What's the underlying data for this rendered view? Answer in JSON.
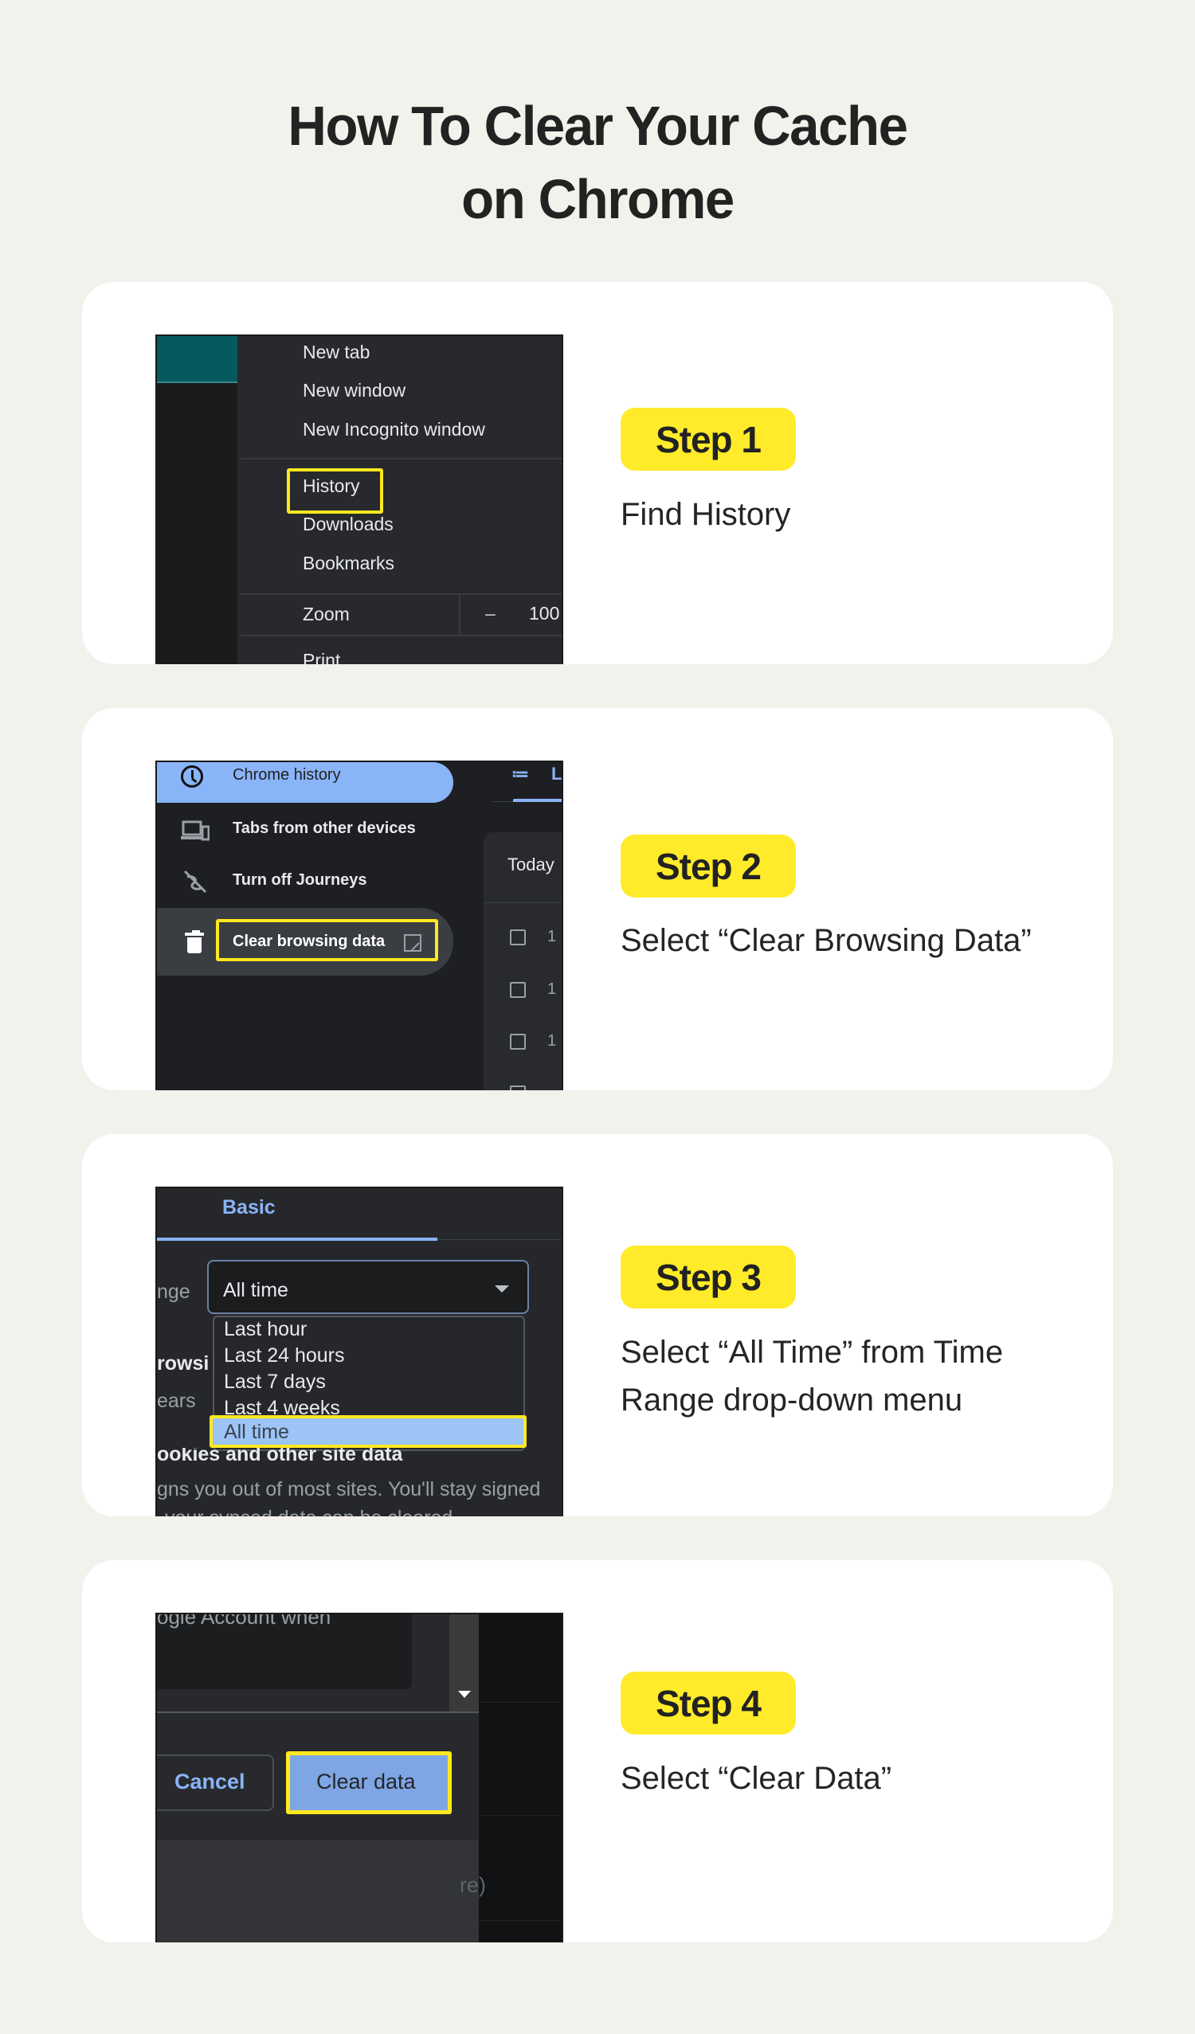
{
  "page": {
    "title_line1": "How To Clear Your Cache",
    "title_line2": "on Chrome",
    "colors": {
      "background": "#f3f1ec",
      "card": "#ffffff",
      "badge": "#ffeb2a",
      "highlight": "#ffe81f",
      "chrome_blue": "#8ab4f8"
    }
  },
  "steps": [
    {
      "badge": "Step 1",
      "description": "Find History",
      "screenshot": {
        "menu_items": [
          "New tab",
          "New window",
          "New Incognito window",
          "History",
          "Downloads",
          "Bookmarks"
        ],
        "zoom_label": "Zoom",
        "zoom_minus": "–",
        "zoom_value": "100",
        "print_label": "Print",
        "highlighted": "History"
      }
    },
    {
      "badge": "Step 2",
      "description": "Select “Clear Browsing Data”",
      "screenshot": {
        "sidebar_items": [
          {
            "label": "Chrome history",
            "icon": "clock-icon"
          },
          {
            "label": "Tabs from other devices",
            "icon": "devices-icon"
          },
          {
            "label": "Turn off Journeys",
            "icon": "journeys-off-icon"
          },
          {
            "label": "Clear browsing data",
            "icon": "trash-icon"
          }
        ],
        "today_label": "Today",
        "row_prefix": "1",
        "list_icon": "list-icon",
        "tab_initial": "L",
        "external_icon": "open-in-new-icon",
        "highlighted": "Clear browsing data"
      }
    },
    {
      "badge": "Step 3",
      "description": "Select “All Time” from Time Range drop-down menu",
      "screenshot": {
        "tab_label": "Basic",
        "range_label_partial": "nge",
        "selected_value": "All time",
        "options": [
          "Last hour",
          "Last 24 hours",
          "Last 7 days",
          "Last 4 weeks",
          "All time"
        ],
        "bg_text_1": "rowsi",
        "bg_text_2": "ears",
        "bg_text_3": "ookies and other site data",
        "bg_text_4": "gns you out of most sites. You'll stay signed",
        "bg_text_5": "your synced data can be cleared",
        "highlighted": "All time"
      }
    },
    {
      "badge": "Step 4",
      "description": "Select “Clear Data”",
      "screenshot": {
        "partial_text": "ogle Account when",
        "cancel_label": "Cancel",
        "clear_label": "Clear data",
        "partial_right": "re)",
        "highlighted": "Clear data"
      }
    }
  ]
}
